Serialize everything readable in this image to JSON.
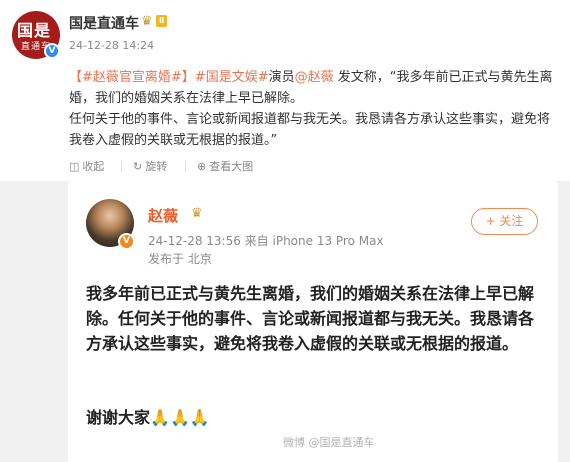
{
  "post": {
    "author": "国是直通车",
    "avatar_text_big": "国是",
    "avatar_text_small": "直通车",
    "verified_mark": "V",
    "level_badge": "Ⅱ",
    "timestamp": "24-12-28 14:24",
    "text": {
      "tag1": "【#赵薇官宣离婚#】",
      "tag2": "#国是文娱#",
      "role": "演员",
      "mention": "@赵薇",
      "line1_rest": " 发文称，“我多年前已正式与黄先生离婚，我们的婚姻关系在法律上早已解除。",
      "line2": "任何关于他的事件、言论或新闻报道都与我无关。我恳请各方承认这些事实，避免将我卷入虚假的关联或无根据的报道。”"
    },
    "actions": {
      "collect": "收起",
      "rotate": "旋转",
      "view_large": "查看大图"
    }
  },
  "screenshot": {
    "name": "赵薇",
    "badge": "V",
    "meta": "24-12-28 13:56  来自 iPhone 13 Pro Max",
    "location": "发布于 北京",
    "follow_label": "+ 关注",
    "body": "我多年前已正式与黄先生离婚，我们的婚姻关系在法律上早已解除。任何关于他的事件、言论或新闻报道都与我无关。我恳请各方承认这些事实，避免将我卷入虚假的关联或无根据的报道。",
    "thanks": "谢谢大家",
    "emoji": "🙏🙏🙏"
  },
  "watermark": "微博 @国是直通车",
  "colors": {
    "accent": "#eb7350",
    "name_orange": "#f05a23",
    "verified_blue": "#2a8cf0",
    "avatar_red": "#a51d1a"
  },
  "icons": [
    "crown-icon",
    "verified-icon",
    "collapse-icon",
    "rotate-icon",
    "zoom-icon",
    "pray-emoji"
  ]
}
